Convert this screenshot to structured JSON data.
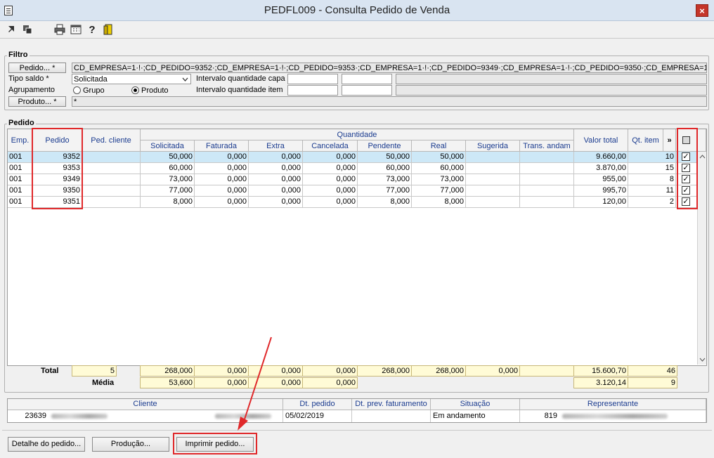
{
  "window": {
    "title": "PEDFL009 - Consulta Pedido de Venda",
    "close_glyph": "×"
  },
  "toolbar": {
    "icons": [
      "arrow-icon",
      "stack-icon",
      "printer-icon",
      "calendar-icon",
      "help-icon",
      "exit-door-icon"
    ]
  },
  "filtro": {
    "group_label": "Filtro",
    "pedido_button": "Pedido... *",
    "pedido_value": "CD_EMPRESA=1·!·;CD_PEDIDO=9352·;CD_EMPRESA=1·!·;CD_PEDIDO=9353·;CD_EMPRESA=1·!·;CD_PEDIDO=9349·;CD_EMPRESA=1·!·;CD_PEDIDO=9350·;CD_EMPRESA=1·!·;CD_PEDIDO=",
    "tipo_saldo_label": "Tipo saldo *",
    "tipo_saldo_value": "Solicitada",
    "intervalo_capa_label": "Intervalo quantidade capa",
    "intervalo_item_label": "Intervalo quantidade item",
    "agrupamento_label": "Agrupamento",
    "radio_grupo": "Grupo",
    "radio_produto": "Produto",
    "selected_agrupamento": "Produto",
    "produto_button": "Produto... *",
    "produto_value": "*"
  },
  "pedido": {
    "group_label": "Pedido",
    "headers": {
      "emp": "Emp.",
      "pedido": "Pedido",
      "ped_cliente": "Ped. cliente",
      "quantidade": "Quantidade",
      "solicitada": "Solicitada",
      "faturada": "Faturada",
      "extra": "Extra",
      "cancelada": "Cancelada",
      "pendente": "Pendente",
      "real": "Real",
      "sugerida": "Sugerida",
      "trans_andam": "Trans. andam",
      "valor_total": "Valor total",
      "qt_item": "Qt. item",
      "more": "»"
    },
    "rows": [
      {
        "emp": "001",
        "pedido": "9352",
        "ped_cliente": "",
        "solicitada": "50,000",
        "faturada": "0,000",
        "extra": "0,000",
        "cancelada": "0,000",
        "pendente": "50,000",
        "real": "50,000",
        "sugerida": "",
        "trans_andam": "",
        "valor_total": "9.660,00",
        "qt_item": "10",
        "checked": true
      },
      {
        "emp": "001",
        "pedido": "9353",
        "ped_cliente": "",
        "solicitada": "60,000",
        "faturada": "0,000",
        "extra": "0,000",
        "cancelada": "0,000",
        "pendente": "60,000",
        "real": "60,000",
        "sugerida": "",
        "trans_andam": "",
        "valor_total": "3.870,00",
        "qt_item": "15",
        "checked": true
      },
      {
        "emp": "001",
        "pedido": "9349",
        "ped_cliente": "",
        "solicitada": "73,000",
        "faturada": "0,000",
        "extra": "0,000",
        "cancelada": "0,000",
        "pendente": "73,000",
        "real": "73,000",
        "sugerida": "",
        "trans_andam": "",
        "valor_total": "955,00",
        "qt_item": "8",
        "checked": true
      },
      {
        "emp": "001",
        "pedido": "9350",
        "ped_cliente": "",
        "solicitada": "77,000",
        "faturada": "0,000",
        "extra": "0,000",
        "cancelada": "0,000",
        "pendente": "77,000",
        "real": "77,000",
        "sugerida": "",
        "trans_andam": "",
        "valor_total": "995,70",
        "qt_item": "11",
        "checked": true
      },
      {
        "emp": "001",
        "pedido": "9351",
        "ped_cliente": "",
        "solicitada": "8,000",
        "faturada": "0,000",
        "extra": "0,000",
        "cancelada": "0,000",
        "pendente": "8,000",
        "real": "8,000",
        "sugerida": "",
        "trans_andam": "",
        "valor_total": "120,00",
        "qt_item": "2",
        "checked": true
      }
    ]
  },
  "totals": {
    "total_label": "Total",
    "media_label": "Média",
    "total": {
      "count": "5",
      "solicitada": "268,000",
      "faturada": "0,000",
      "extra": "0,000",
      "cancelada": "0,000",
      "pendente": "268,000",
      "real": "268,000",
      "sugerida": "0,000",
      "valor_total": "15.600,70",
      "qt_item": "46"
    },
    "media": {
      "solicitada": "53,600",
      "faturada": "0,000",
      "extra": "0,000",
      "cancelada": "0,000",
      "valor_total": "3.120,14",
      "qt_item": "9"
    }
  },
  "info": {
    "headers": {
      "cliente": "Cliente",
      "dt_pedido": "Dt. pedido",
      "dt_prev": "Dt. prev. faturamento",
      "situacao": "Situação",
      "representante": "Representante"
    },
    "cliente_code": "23639",
    "dt_pedido": "05/02/2019",
    "dt_prev": "",
    "situacao": "Em andamento",
    "representante_code": "819"
  },
  "buttons": {
    "detalhe": "Detalhe do pedido...",
    "producao": "Produção...",
    "imprimir": "Imprimir pedido..."
  },
  "colors": {
    "highlight_red": "#e0282a",
    "selected_row": "#cde8f7",
    "totals_bg": "#fffbd6",
    "header_text": "#1a3b8f"
  }
}
